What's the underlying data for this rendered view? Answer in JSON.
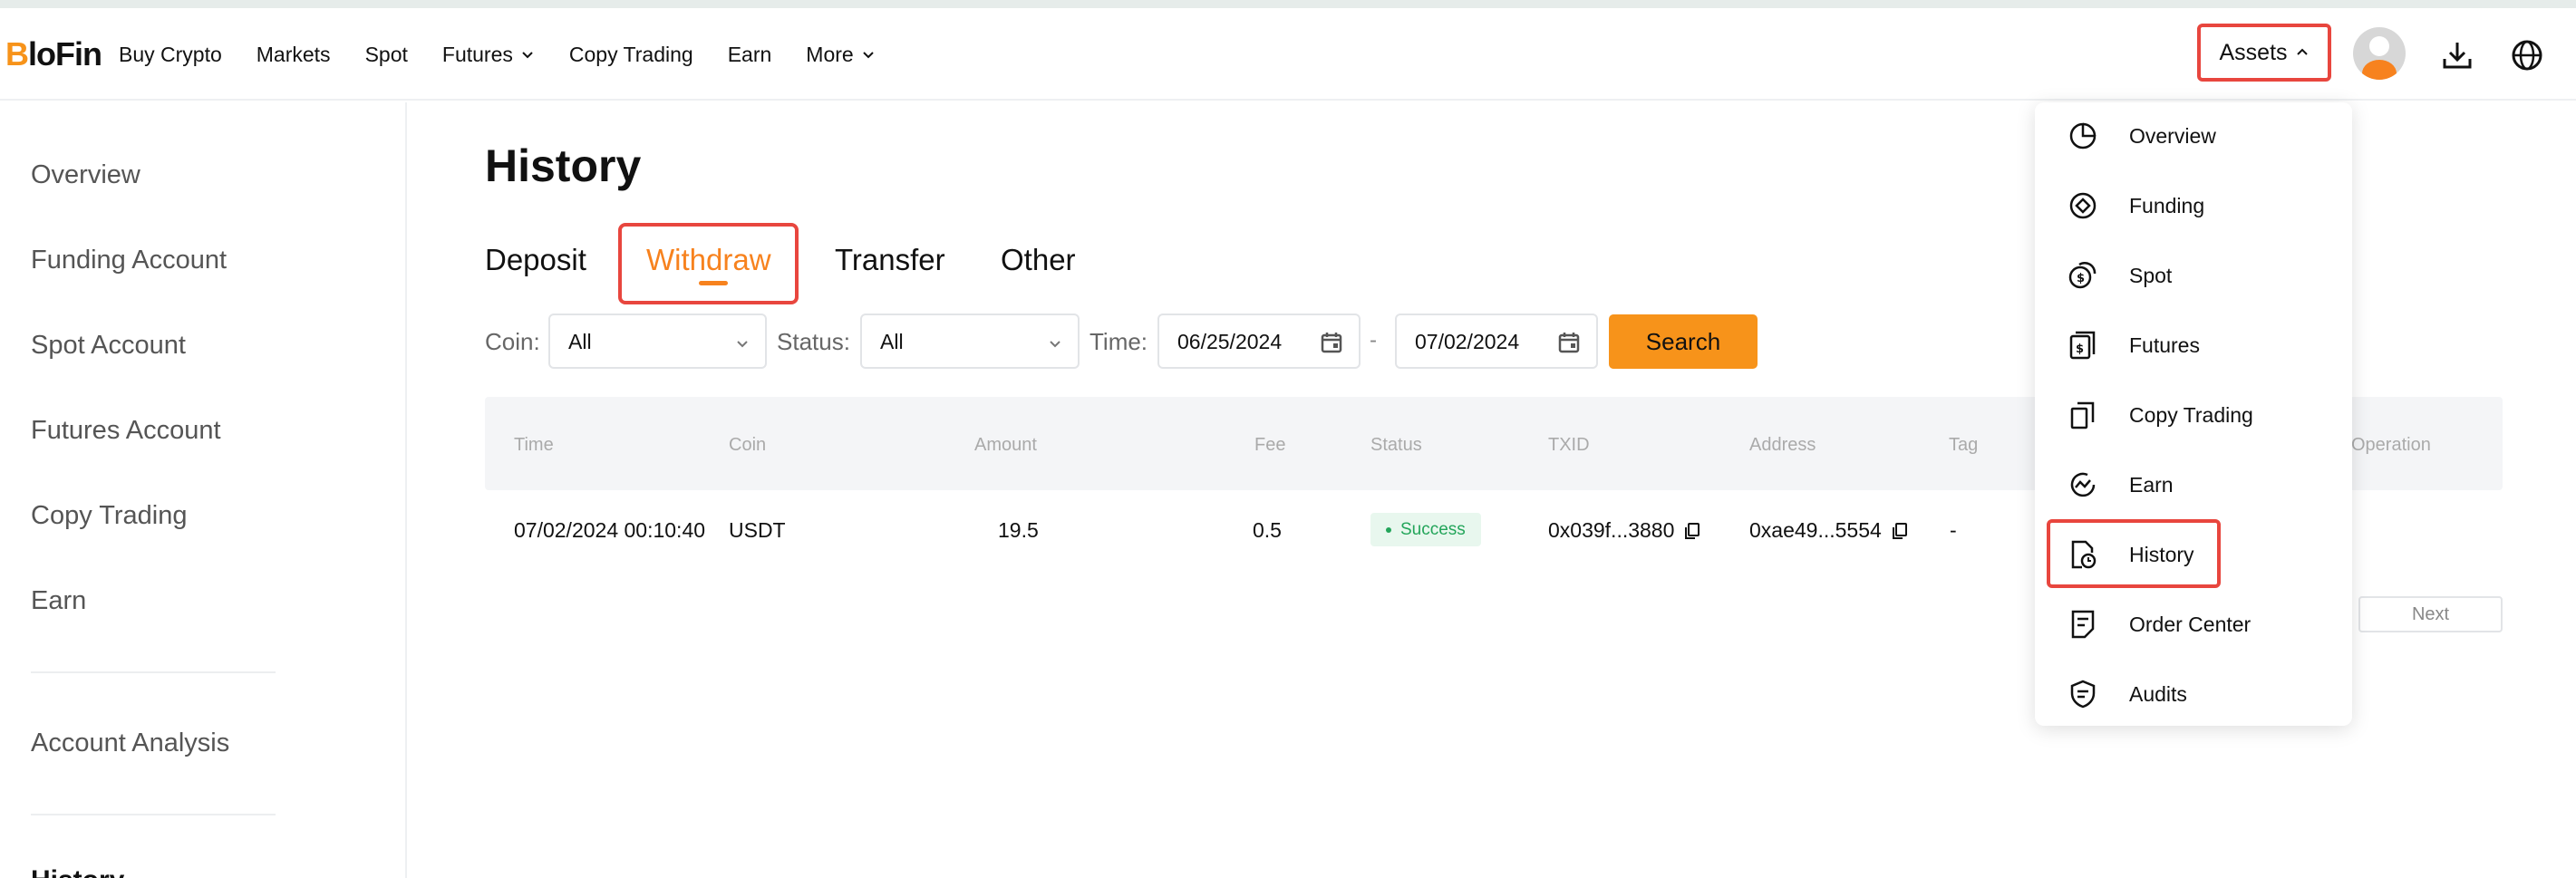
{
  "colors": {
    "accent": "#f7931a",
    "highlight_box": "#e8463e",
    "success": "#23a55a"
  },
  "nav": {
    "logo_b": "B",
    "logo_rest": "loFin",
    "items": [
      {
        "label": "Buy Crypto",
        "icon": ""
      },
      {
        "label": "Markets",
        "icon": ""
      },
      {
        "label": "Spot",
        "icon": ""
      },
      {
        "label": "Futures",
        "icon": "chevron-down-icon"
      },
      {
        "label": "Copy Trading",
        "icon": ""
      },
      {
        "label": "Earn",
        "icon": ""
      },
      {
        "label": "More",
        "icon": "chevron-down-icon"
      }
    ],
    "assets_label": "Assets",
    "assets_icon": "chevron-up-icon",
    "right_icons": [
      "avatar",
      "download-icon",
      "globe-icon"
    ]
  },
  "sidebar": {
    "items": [
      {
        "label": "Overview"
      },
      {
        "label": "Funding Account"
      },
      {
        "label": "Spot Account"
      },
      {
        "label": "Futures Account"
      },
      {
        "label": "Copy Trading"
      },
      {
        "label": "Earn"
      }
    ],
    "analysis_label": "Account Analysis",
    "partial_label": "History"
  },
  "main": {
    "title": "History",
    "tabs": [
      {
        "label": "Deposit",
        "active": false
      },
      {
        "label": "Withdraw",
        "active": true
      },
      {
        "label": "Transfer",
        "active": false
      },
      {
        "label": "Other",
        "active": false
      }
    ],
    "filters": {
      "coin_label": "Coin:",
      "coin_value": "All",
      "status_label": "Status:",
      "status_value": "All",
      "time_label": "Time:",
      "start_date": "06/25/2024",
      "date_separator": "-",
      "end_date": "07/02/2024",
      "search_label": "Search"
    },
    "table": {
      "columns": [
        "Time",
        "Coin",
        "Amount",
        "Fee",
        "Status",
        "TXID",
        "Address",
        "Tag",
        "Operation"
      ],
      "rows": [
        {
          "time": "07/02/2024 00:10:40",
          "coin": "USDT",
          "amount": "19.5",
          "fee": "0.5",
          "status": "Success",
          "txid": "0x039f...3880",
          "address": "0xae49...5554",
          "tag": "-"
        }
      ]
    },
    "pagination": {
      "next_label": "Next"
    }
  },
  "dropdown": {
    "items": [
      {
        "label": "Overview",
        "icon": "pie-chart-icon"
      },
      {
        "label": "Funding",
        "icon": "funding-icon"
      },
      {
        "label": "Spot",
        "icon": "coins-icon"
      },
      {
        "label": "Futures",
        "icon": "futures-icon"
      },
      {
        "label": "Copy Trading",
        "icon": "copy-trading-icon"
      },
      {
        "label": "Earn",
        "icon": "earn-icon"
      },
      {
        "label": "History",
        "icon": "history-icon"
      },
      {
        "label": "Order Center",
        "icon": "order-center-icon"
      },
      {
        "label": "Audits",
        "icon": "audits-icon"
      }
    ]
  }
}
